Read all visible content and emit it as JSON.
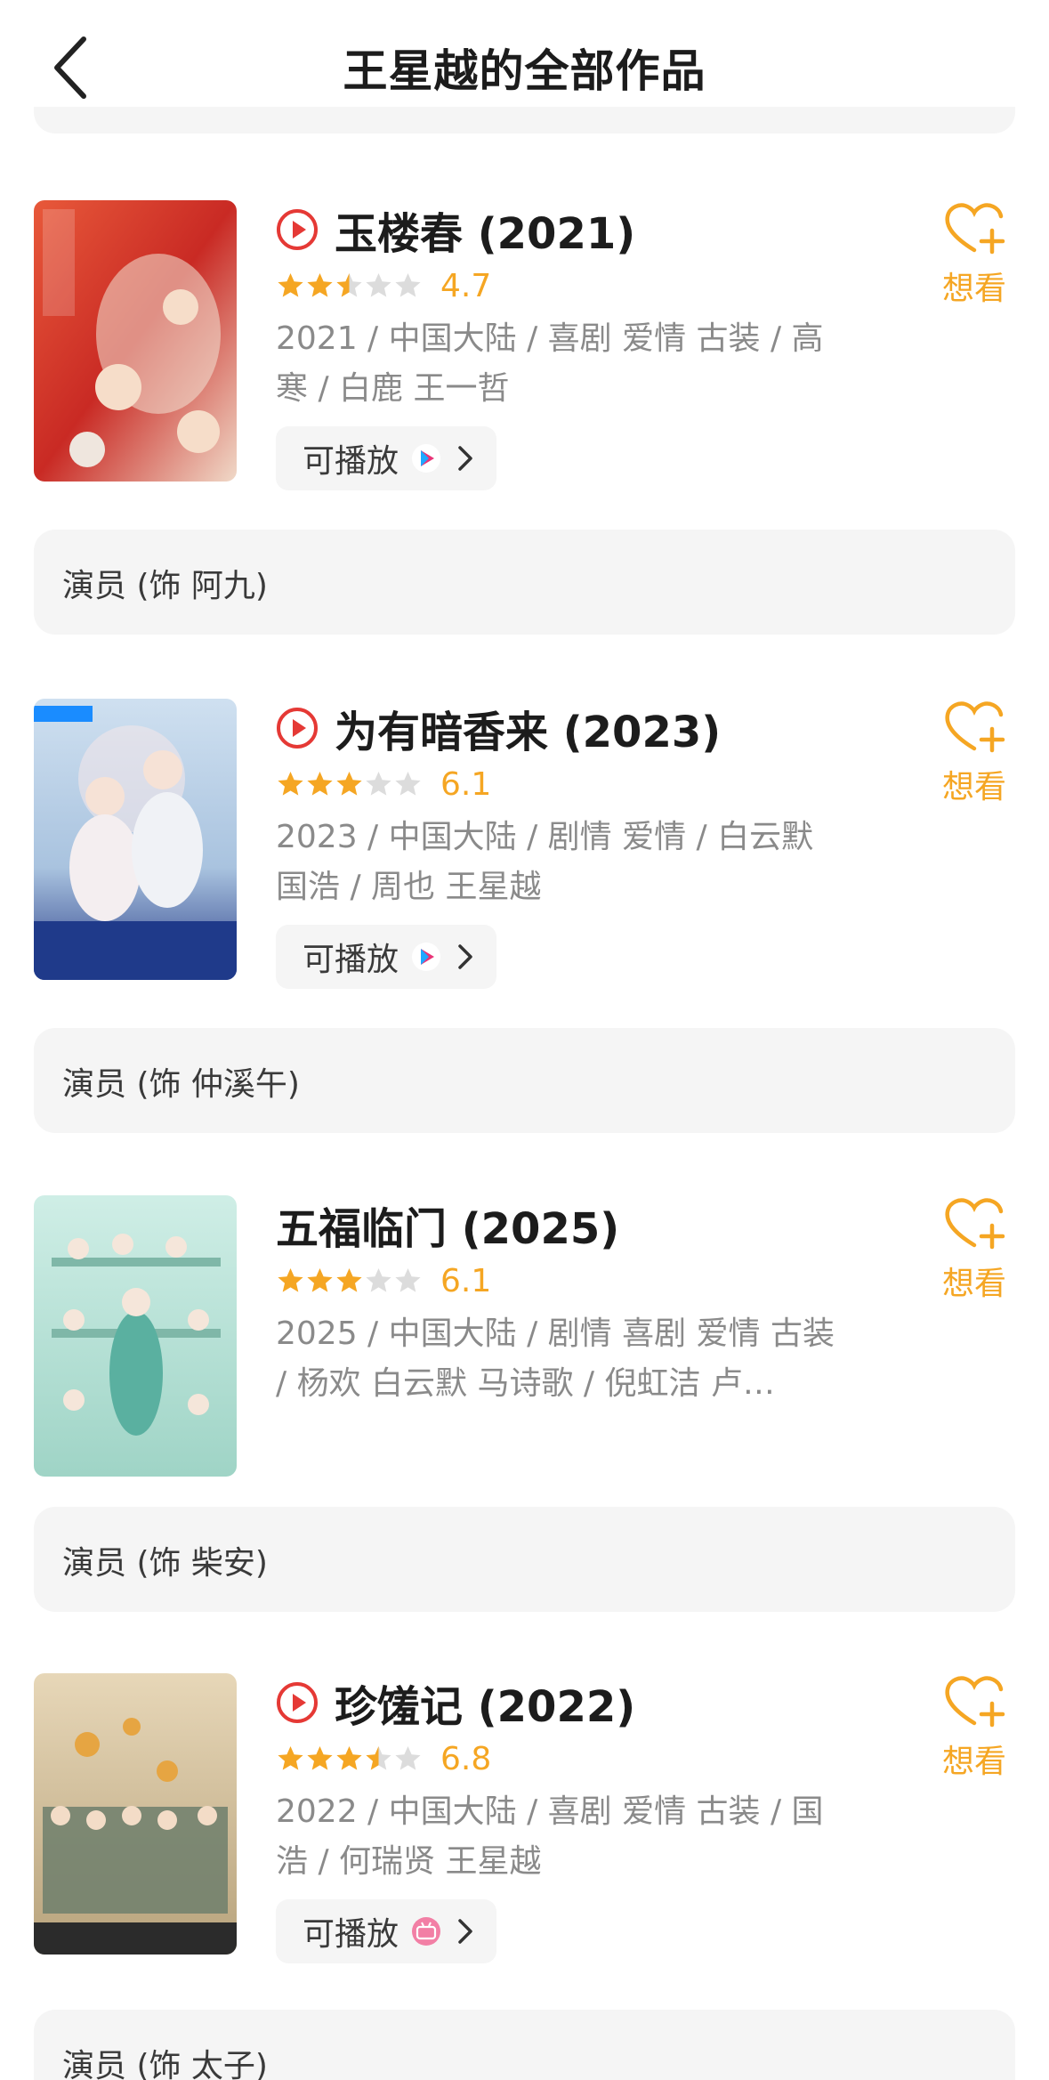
{
  "header": {
    "title": "王星越的全部作品"
  },
  "colors": {
    "accent": "#f5a623",
    "play_red": "#e53935",
    "star_grey": "#dcdcdc"
  },
  "works": [
    {
      "title": "玉楼春 (2021)",
      "playable": true,
      "stars": 2.5,
      "score": "4.7",
      "meta": "2021 / 中国大陆 / 喜剧 爱情 古装 / 高寒 / 白鹿 王一哲",
      "play_label": "可播放",
      "platform_icon": "youku-icon",
      "want_label": "想看",
      "role": "演员 (饰 阿九)"
    },
    {
      "title": "为有暗香来 (2023)",
      "playable": true,
      "stars": 3,
      "score": "6.1",
      "meta": "2023 / 中国大陆 / 剧情 爱情 / 白云默 国浩 / 周也 王星越",
      "play_label": "可播放",
      "platform_icon": "youku-icon",
      "want_label": "想看",
      "role": "演员 (饰 仲溪午)"
    },
    {
      "title": "五福临门 (2025)",
      "playable": false,
      "stars": 3,
      "score": "6.1",
      "meta": "2025 / 中国大陆 / 剧情 喜剧 爱情 古装 / 杨欢 白云默 马诗歌 / 倪虹洁 卢…",
      "want_label": "想看",
      "role": "演员 (饰 柴安)"
    },
    {
      "title": "珍馐记 (2022)",
      "playable": true,
      "stars": 3.5,
      "score": "6.8",
      "meta": "2022 / 中国大陆 / 喜剧 爱情 古装 / 国浩 / 何瑞贤 王星越",
      "play_label": "可播放",
      "platform_icon": "bilibili-icon",
      "want_label": "想看",
      "role": "演员 (饰 太子)"
    }
  ]
}
